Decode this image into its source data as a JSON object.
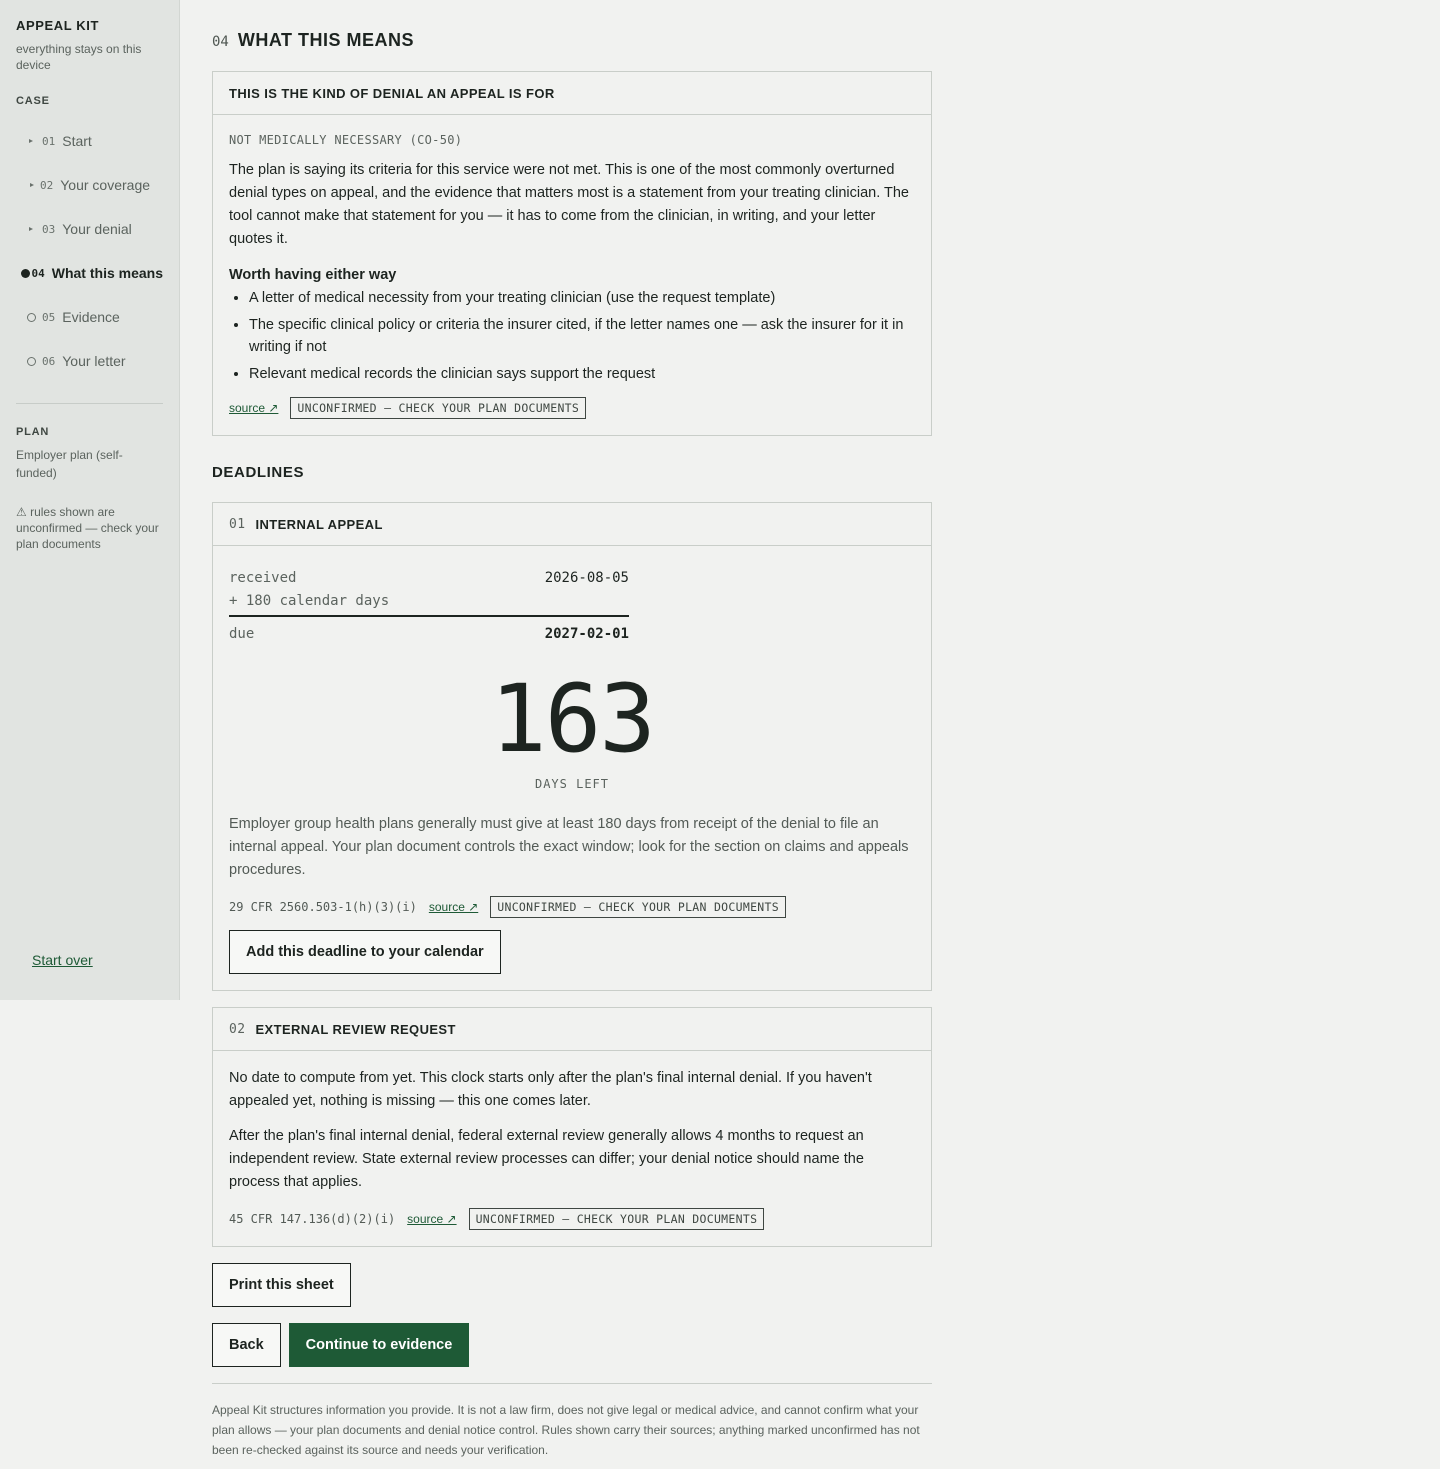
{
  "sidebar": {
    "brand": "APPEAL KIT",
    "tagline": "everything stays on this device",
    "case_label": "CASE",
    "items": [
      {
        "num": "01",
        "label": "Start"
      },
      {
        "num": "02",
        "label": "Your coverage"
      },
      {
        "num": "03",
        "label": "Your denial"
      },
      {
        "num": "04",
        "label": "What this means"
      },
      {
        "num": "05",
        "label": "Evidence"
      },
      {
        "num": "06",
        "label": "Your letter"
      }
    ],
    "plan_label": "PLAN",
    "plan_value": "Employer plan (self-funded)",
    "warning": "⚠ rules shown are unconfirmed — check your plan documents",
    "start_over": "Start over"
  },
  "page": {
    "num": "04",
    "title": "WHAT THIS MEANS"
  },
  "denial_card": {
    "header": "THIS IS THE KIND OF DENIAL AN APPEAL IS FOR",
    "code": "NOT MEDICALLY NECESSARY (CO-50)",
    "paragraph": "The plan is saying its criteria for this service were not met. This is one of the most commonly overturned denial types on appeal, and the evidence that matters most is a statement from your treating clinician. The tool cannot make that statement for you — it has to come from the clinician, in writing, and your letter quotes it.",
    "worth_heading": "Worth having either way",
    "bullets": [
      "A letter of medical necessity from your treating clinician (use the request template)",
      "The specific clinical policy or criteria the insurer cited, if the letter names one — ask the insurer for it in writing if not",
      "Relevant medical records the clinician says support the request"
    ],
    "source_label": "source ↗",
    "badge": "UNCONFIRMED — CHECK YOUR PLAN DOCUMENTS"
  },
  "deadlines_title": "DEADLINES",
  "internal_appeal": {
    "num": "01",
    "title": "INTERNAL APPEAL",
    "received_label": "received",
    "received_date": "2026-08-05",
    "plus_label": "+ 180 calendar days",
    "due_label": "due",
    "due_date": "2027-02-01",
    "days": "163",
    "days_label": "DAYS LEFT",
    "description": "Employer group health plans generally must give at least 180 days from receipt of the denial to file an internal appeal. Your plan document controls the exact window; look for the section on claims and appeals procedures.",
    "reference": "29 CFR 2560.503-1(h)(3)(i)",
    "source_label": "source ↗",
    "badge": "UNCONFIRMED — CHECK YOUR PLAN DOCUMENTS",
    "calendar_button": "Add this deadline to your calendar"
  },
  "external_review": {
    "num": "02",
    "title": "EXTERNAL REVIEW REQUEST",
    "paragraph1": "No date to compute from yet. This clock starts only after the plan's final internal denial. If you haven't appealed yet, nothing is missing — this one comes later.",
    "paragraph2": "After the plan's final internal denial, federal external review generally allows 4 months to request an independent review. State external review processes can differ; your denial notice should name the process that applies.",
    "reference": "45 CFR 147.136(d)(2)(i)",
    "source_label": "source ↗",
    "badge": "UNCONFIRMED — CHECK YOUR PLAN DOCUMENTS"
  },
  "actions": {
    "print": "Print this sheet",
    "back": "Back",
    "continue": "Continue to evidence"
  },
  "disclaimer": "Appeal Kit structures information you provide. It is not a law firm, does not give legal or medical advice, and cannot confirm what your plan allows — your plan documents and denial notice control. Rules shown carry their sources; anything marked unconfirmed has not been re-checked against its source and needs your verification.",
  "colors": {
    "accent": "#1e5a36",
    "text": "#1d2420",
    "background": "#f1f2f0",
    "sidebar": "#e1e4e1"
  }
}
